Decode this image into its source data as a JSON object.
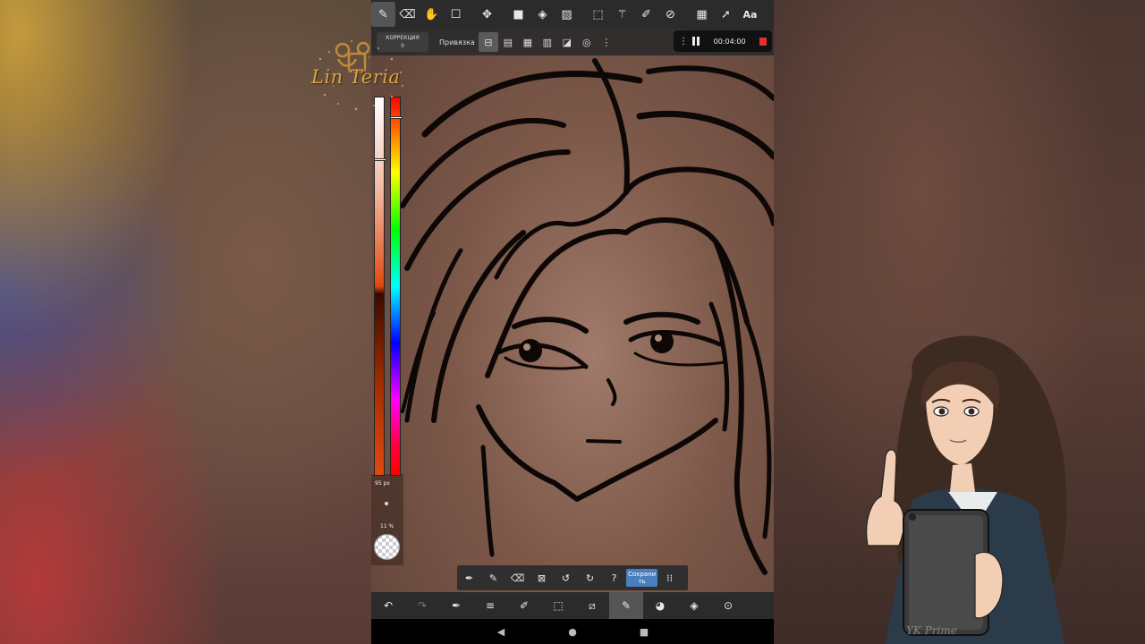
{
  "toolbar": {
    "tools": [
      "brush-icon",
      "eraser-icon",
      "hand-icon",
      "shape-icon",
      "move-icon",
      "fill-rect-icon",
      "bucket-icon",
      "gradient-icon",
      "select-rect-icon",
      "magic-wand-icon",
      "select-pen-icon",
      "select-eraser-icon",
      "filter-icon",
      "pointer-icon"
    ],
    "text_tool_label": "Aa"
  },
  "subbar": {
    "correction_label": "КОРРЕКЦИЯ",
    "correction_value": "0",
    "snap_label": "Привязка"
  },
  "recorder": {
    "time": "00:04:00"
  },
  "color_panel": {
    "brush_size": "95 px",
    "opacity": "11 %",
    "lightness_marker": 0.16,
    "hue_marker": 0.05
  },
  "floating_bar": {
    "save_label_line1": "Сохрани",
    "save_label_line2": "ть"
  },
  "watermark_text": "YK Prime",
  "logo_text": "Lin Teria",
  "colors": {
    "toolbar_bg": "#2b2b2b",
    "record": "#e03030",
    "save_button": "#4a7fbf"
  }
}
